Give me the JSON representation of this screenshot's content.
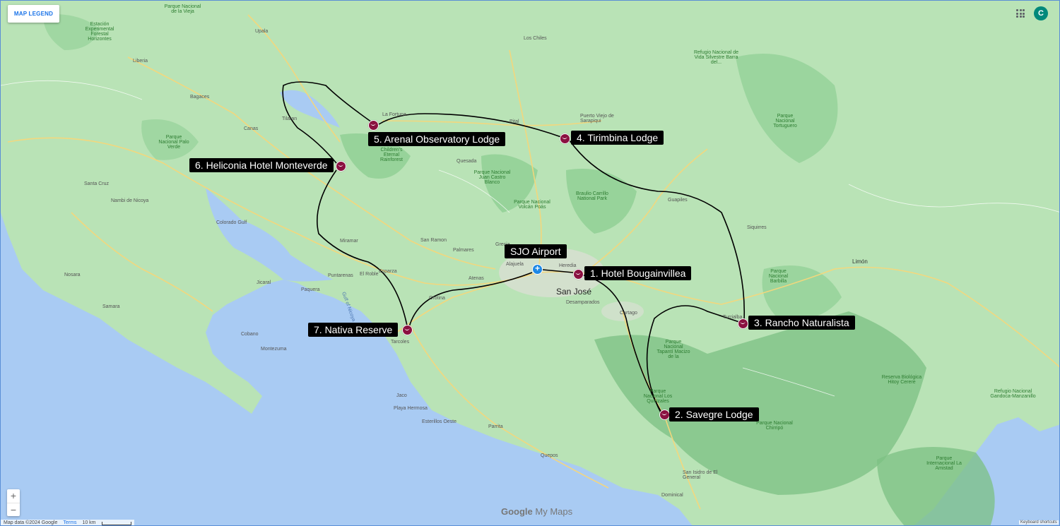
{
  "legend_button": "MAP LEGEND",
  "user_initial": "C",
  "markers": [
    {
      "id": "hotel-bougainvillea",
      "label": "1. Hotel Bougainvillea"
    },
    {
      "id": "savegre-lodge",
      "label": "2. Savegre Lodge"
    },
    {
      "id": "rancho-naturalista",
      "label": "3. Rancho Naturalista"
    },
    {
      "id": "tirimbina-lodge",
      "label": "4. Tirimbina Lodge"
    },
    {
      "id": "arenal-observatory-lodge",
      "label": "5. Arenal Observatory Lodge"
    },
    {
      "id": "heliconia-hotel",
      "label": "6. Heliconia Hotel Monteverde"
    },
    {
      "id": "nativa-reserve",
      "label": "7. Nativa Reserve"
    },
    {
      "id": "sjo-airport",
      "label": "SJO Airport"
    }
  ],
  "places": {
    "san_jose": "San José",
    "desamparados": "Desamparados",
    "cartago": "Cartago",
    "alajuela": "Alajuela",
    "heredia": "Heredia",
    "grecia": "Grecia",
    "palmares": "Palmares",
    "san_ramon": "San Ramon",
    "atenas": "Atenas",
    "orotina": "Orotina",
    "tarcoles": "Tarcoles",
    "jaco": "Jaco",
    "playa_hermosa": "Playa Hermosa",
    "quepos": "Quepos",
    "parrita": "Parrita",
    "esterillos": "Esterillos Oeste",
    "dominical": "Dominical",
    "san_isidro": "San Isidro de El General",
    "puntarenas": "Puntarenas",
    "miramar": "Miramar",
    "esparza": "Esparza",
    "el_roble": "El Roble",
    "liberia": "Liberia",
    "canas": "Canas",
    "tilaran": "Tilaran",
    "bagaces": "Bagaces",
    "nicoya": "Nambi de Nicoya",
    "santa_cruz": "Santa Cruz",
    "jicaral": "Jicaral",
    "paquera": "Paquera",
    "montezuma": "Montezuma",
    "cobano": "Cobano",
    "samara": "Samara",
    "nosara": "Nosara",
    "la_fortuna": "La Fortuna",
    "quesada": "Quesada",
    "puerto_viejo": "Puerto Viejo de Sarapiqui",
    "guapiles": "Guapiles",
    "siquirres": "Siquirres",
    "turrialba": "Turrialba",
    "limon": "Limón",
    "upala": "Upala",
    "los_chiles": "Los Chiles",
    "pital": "Pital",
    "colorado_gulf": "Colorado Gulf",
    "gulf_nicoya": "Gulf of Nicoya",
    "palo_verde": "Parque Nacional Palo Verde",
    "tortuguero": "Parque Nacional Tortuguero",
    "braulio_carrillo": "Braulio Carrillo National Park",
    "poas": "Parque Nacional Volcán Poás",
    "juan_castro": "Parque Nacional Juan Castro Blanco",
    "childrens_rainforest": "Children's Eternal Rainforest",
    "tapanti": "Parque Nacional Tapantí Macizo de la",
    "los_quetzales": "Parque Nacional Los Quetzales",
    "chirripo": "Parque Nacional Chirripó",
    "barbilla": "Parque Nacional Barbilla",
    "la_amistad": "Parque Internacional La Amistad",
    "hitoy_cerere": "Reserva Biológica Hitoy Cerere",
    "cahuita": "Refugio Nacional Gandoca-Manzanillo",
    "barra_del_colorado": "Refugio Nacional de Vida Silvestre Barra del...",
    "guanacaste": "Estación Experimental Forestal Horizontes",
    "rincon": "Parque Nacional de la Vieja"
  },
  "footer": {
    "map_data": "Map data ©2024 Google",
    "terms": "Terms",
    "scale": "10 km",
    "shortcuts": "Keyboard shortcuts"
  },
  "brand": {
    "google": "Google",
    "mymaps": "My Maps"
  },
  "zoom": {
    "in": "+",
    "out": "−"
  },
  "colors": {
    "land": "#b9e3b6",
    "water": "#a9cbf3",
    "park": "#8fce94",
    "road": "#f6d77b",
    "route": "#000000",
    "pin": "#8a1140",
    "airport": "#1e88e5"
  }
}
